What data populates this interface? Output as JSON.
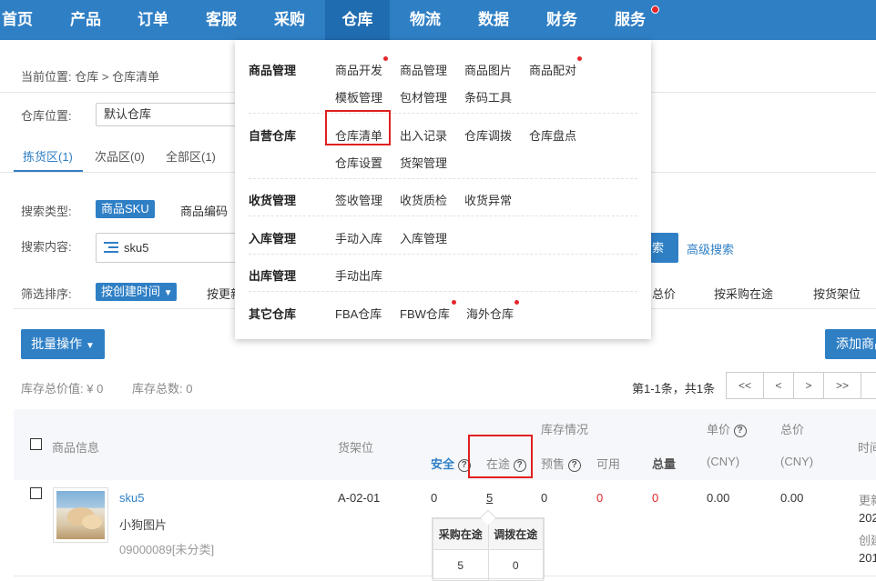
{
  "nav": {
    "items": [
      "首页",
      "产品",
      "订单",
      "客服",
      "采购",
      "仓库",
      "物流",
      "数据",
      "财务",
      "服务"
    ],
    "active_index": 5,
    "badge_item": "服务"
  },
  "breadcrumb": {
    "prefix": "当前位置:",
    "path": "仓库 > 仓库清单"
  },
  "warehouse": {
    "label": "仓库位置:",
    "value": "默认仓库"
  },
  "tabs": [
    "拣货区(1)",
    "次品区(0)",
    "全部区(1)"
  ],
  "search": {
    "type_label": "搜索类型:",
    "type_active": "商品SKU",
    "type_other": "商品编码",
    "content_label": "搜索内容:",
    "content_value": "sku5",
    "search_btn": "索",
    "advanced": "高级搜索"
  },
  "sort": {
    "label": "筛选排序:",
    "active": "按创建时间",
    "items": [
      "按更新",
      "总价",
      "按采购在途",
      "按货架位"
    ]
  },
  "actions": {
    "batch": "批量操作",
    "add": "添加商品"
  },
  "stats": {
    "total_value": "库存总价值: ¥ 0",
    "total_count": "库存总数: 0"
  },
  "pagination": {
    "summary": "第1-1条，共1条",
    "buttons": [
      "<<",
      "<",
      ">",
      ">>"
    ]
  },
  "table": {
    "headers": {
      "product": "商品信息",
      "shelf": "货架位",
      "stock": "库存情况",
      "safe": "安全",
      "transit": "在途",
      "presale": "预售",
      "available": "可用",
      "total": "总量",
      "price": "单价",
      "price_unit": "(CNY)",
      "total_price": "总价",
      "total_price_unit": "(CNY)",
      "time": "时间"
    },
    "rows": [
      {
        "sku": "sku5",
        "name": "小狗图片",
        "code": "09000089[未分类]",
        "shelf": "A-02-01",
        "safe": "0",
        "transit": "5",
        "presale": "0",
        "available": "0",
        "total": "0",
        "price": "0.00",
        "total_price": "0.00",
        "time_lines": [
          "更新",
          "202",
          "创建",
          "201"
        ]
      }
    ]
  },
  "transit_popup": {
    "headers": [
      "采购在途",
      "调拨在途"
    ],
    "values": [
      "5",
      "0"
    ]
  },
  "dropdown": {
    "groups": [
      {
        "title": "商品管理",
        "rows": [
          [
            "商品开发",
            "商品管理",
            "商品图片",
            "商品配对"
          ],
          [
            "模板管理",
            "包材管理",
            "条码工具"
          ]
        ]
      },
      {
        "title": "自营仓库",
        "rows": [
          [
            "仓库清单",
            "出入记录",
            "仓库调拨",
            "仓库盘点"
          ],
          [
            "仓库设置",
            "货架管理"
          ]
        ]
      },
      {
        "title": "收货管理",
        "rows": [
          [
            "签收管理",
            "收货质检",
            "收货异常"
          ]
        ]
      },
      {
        "title": "入库管理",
        "rows": [
          [
            "手动入库",
            "入库管理"
          ]
        ]
      },
      {
        "title": "出库管理",
        "rows": [
          [
            "手动出库"
          ]
        ]
      },
      {
        "title": "其它仓库",
        "rows": [
          [
            "FBA仓库",
            "FBW仓库",
            "海外仓库"
          ]
        ]
      }
    ]
  },
  "colors": {
    "primary": "#2f7fc5",
    "nav_active": "#1f6cb0",
    "danger": "#e5262b",
    "highlight_box": "#e02020"
  }
}
